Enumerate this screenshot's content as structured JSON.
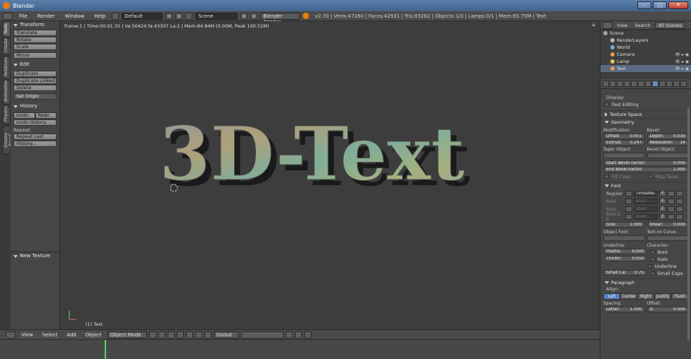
{
  "window": {
    "title": "Blender",
    "btn_min": "–",
    "btn_max": "□",
    "btn_close": "✕"
  },
  "info": {
    "menus": [
      "File",
      "Render",
      "Window",
      "Help"
    ],
    "layout": "Default",
    "scene": "Scene",
    "engine": "Blender Render",
    "stats": "v2.70 | Verts:47160 | Faces:42931 | Tris:83262 | Objects:1/3 | Lamps:0/1 | Mem:65.75M | Text"
  },
  "toolshelf": {
    "tabs": [
      "Tools",
      "Create",
      "Relations",
      "Animation",
      "Physics",
      "Grease Pencil"
    ],
    "transform": {
      "title": "Transform",
      "buttons": [
        "Translate",
        "Rotate",
        "Scale"
      ],
      "mirror": "Mirror"
    },
    "edit": {
      "title": "Edit",
      "buttons": [
        "Duplicate",
        "Duplicate Linked",
        "Delete"
      ],
      "set_origin": "Set Origin"
    },
    "history": {
      "title": "History",
      "undo": "Undo",
      "redo": "Redo",
      "undo_history": "Undo History",
      "repeat_label": "Repeat:",
      "repeat_last": "Repeat Last",
      "history_btn": "History..."
    },
    "new_texture": "New Texture"
  },
  "viewport": {
    "info_line": "frame:1 | Time:00:01.35 | Ve:50424 fa:43307 La:1 | Mem:84.84M (0.00M, Peak 100.51M)",
    "object_label": "(1) Text",
    "text3d": "3D-Text"
  },
  "view_header": {
    "menus": [
      "View",
      "Select",
      "Add",
      "Object"
    ],
    "mode": "Object Mode",
    "orientation": "Global"
  },
  "outliner": {
    "menus": [
      "View",
      "Search",
      "All Scenes"
    ],
    "items": [
      {
        "name": "Scene",
        "color": "#9aa3b5"
      },
      {
        "name": "RenderLayers",
        "color": "#b8b8b8"
      },
      {
        "name": "World",
        "color": "#7fa3d6"
      },
      {
        "name": "Camera",
        "color": "#e89a4c"
      },
      {
        "name": "Lamp",
        "color": "#e8c24c"
      },
      {
        "name": "Text",
        "color": "#e89a4c"
      }
    ]
  },
  "properties": {
    "display_label": "Display:",
    "fast_editing": "Fast Editing",
    "texture_space": "Texture Space",
    "geometry": {
      "title": "Geometry",
      "modification": "Modification:",
      "bevel": "Bevel:",
      "offset": {
        "label": "Offset:",
        "value": "0.001"
      },
      "depth": {
        "label": "Depth:",
        "value": "0.030"
      },
      "extrude": {
        "label": "Extrud:",
        "value": "0.247"
      },
      "resolution": {
        "label": "Resolution:",
        "value": "14"
      },
      "taper_object": "Taper Object:",
      "bevel_object": "Bevel Object:",
      "start_bevel": {
        "label": "Start Bevel Factor:",
        "value": "0.000"
      },
      "end_bevel": {
        "label": "End Bevel Factor:",
        "value": "1.000"
      },
      "fill_caps": "Fill Caps",
      "map_taper": "Map Taper"
    },
    "font": {
      "title": "Font",
      "rows": [
        {
          "label": "Regular",
          "name": "TimesNe..."
        },
        {
          "label": "Bold",
          "name": "Bfont"
        },
        {
          "label": "Italic",
          "name": "Bfont"
        },
        {
          "label": "Bold & It",
          "name": "Bfont"
        }
      ],
      "f_btn": "F",
      "size": {
        "label": "Size:",
        "value": "1.000"
      },
      "shear": {
        "label": "Shear:",
        "value": "0.000"
      },
      "object_font": "Object Font:",
      "text_on_curve": "Text on Curve:",
      "underline": "Underline:",
      "character": "Character:",
      "position": {
        "label": "Positio:",
        "value": "0.000"
      },
      "thickness": {
        "label": "Thickn:",
        "value": "0.050"
      },
      "bold": "Bold",
      "italic": "Italic",
      "underline_chk": "Underline",
      "small_caps_scale": {
        "label": "Small Ca:",
        "value": "0.75"
      },
      "small_caps": "Small Caps"
    },
    "paragraph": {
      "title": "Paragraph",
      "align": "Align:",
      "align_options": [
        "Left",
        "Center",
        "Right",
        "Justify",
        "Flush"
      ],
      "spacing": "Spacing:",
      "offset_label": "Offset:",
      "letter": {
        "label": "Letter:",
        "value": "1.000"
      },
      "x": {
        "label": "X:",
        "value": "0.000"
      }
    }
  }
}
